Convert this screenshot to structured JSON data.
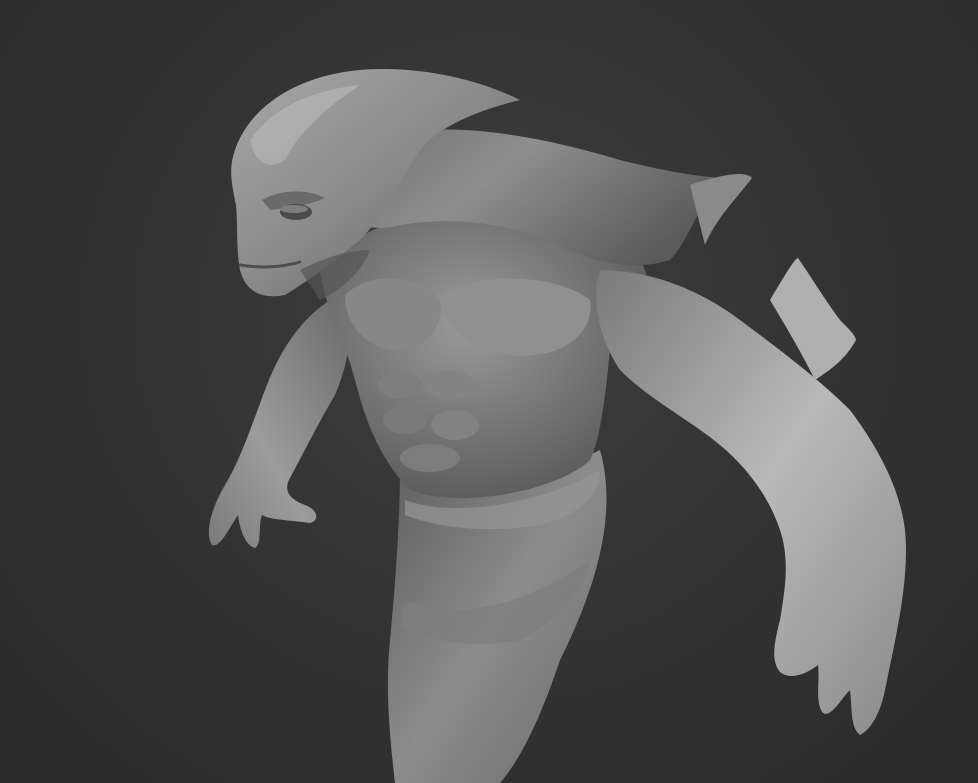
{
  "viewport": {
    "background_color": "#333333",
    "subject": "sculpt-model",
    "material_color": "#9a9a9a"
  }
}
